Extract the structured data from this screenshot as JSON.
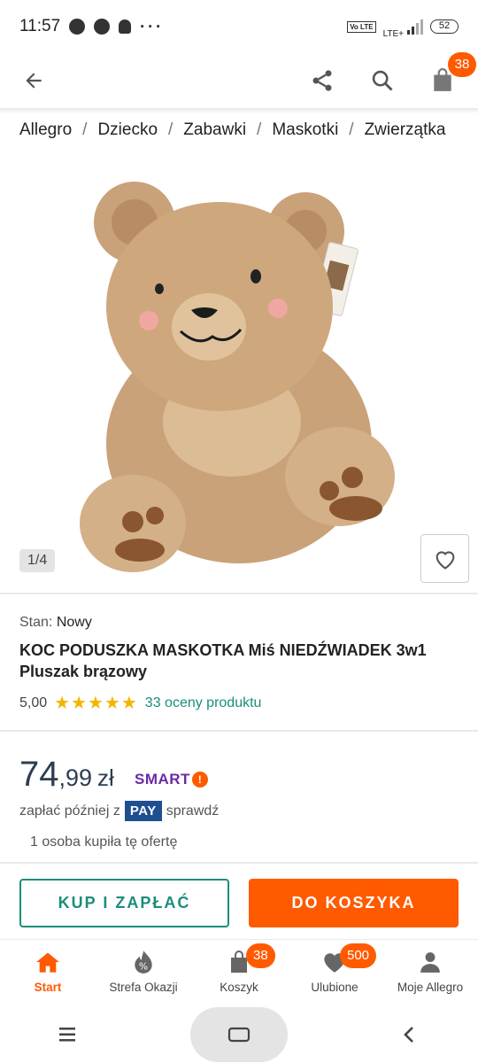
{
  "status_bar": {
    "time": "11:57",
    "lte_label": "LTE+",
    "volte_label": "Vo LTE",
    "battery": "52"
  },
  "app_bar": {
    "cart_badge": "38"
  },
  "breadcrumb": [
    "Allegro",
    "Dziecko",
    "Zabawki",
    "Maskotki",
    "Zwierzątka"
  ],
  "gallery": {
    "counter": "1/4"
  },
  "product": {
    "condition_label": "Stan:",
    "condition_value": "Nowy",
    "title": "KOC PODUSZKA MASKOTKA Miś NIEDŹWIADEK 3w1 Pluszak brązowy",
    "rating_score": "5,00",
    "rating_stars": 5,
    "reviews_text": "33 oceny produktu"
  },
  "price": {
    "integer": "74",
    "decimal": ",99",
    "currency": "zł",
    "smart_label": "SMART",
    "pay_later_prefix": "zapłać później z",
    "pay_logo": "PAY",
    "pay_later_link": "sprawdź",
    "bought_text": "1 osoba kupiła tę ofertę"
  },
  "buttons": {
    "buy_now": "KUP I ZAPŁAĆ",
    "add_to_cart": "DO KOSZYKA"
  },
  "bottom_nav": {
    "items": [
      {
        "label": "Start",
        "icon": "home-icon",
        "active": true
      },
      {
        "label": "Strefa Okazji",
        "icon": "deals-icon"
      },
      {
        "label": "Koszyk",
        "icon": "bag-icon",
        "badge": "38"
      },
      {
        "label": "Ulubione",
        "icon": "heart-icon",
        "badge": "500"
      },
      {
        "label": "Moje Allegro",
        "icon": "user-icon"
      }
    ]
  },
  "colors": {
    "accent": "#ff5a00",
    "teal": "#1a8e7b",
    "price": "#2c3e50",
    "smart": "#6b2aa6",
    "pay": "#1d4f91",
    "star": "#f3b600"
  }
}
